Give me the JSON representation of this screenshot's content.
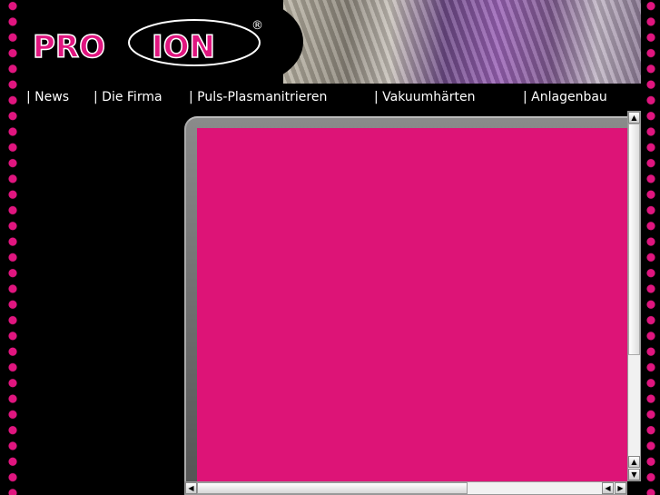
{
  "logo": {
    "text_left": "PRO",
    "text_right": "ION",
    "reg": "®"
  },
  "nav": [
    {
      "label": "| News"
    },
    {
      "label": "| Die Firma"
    },
    {
      "label": "| Puls-Plasmanitrieren"
    },
    {
      "label": "| Vakuumhärten"
    },
    {
      "label": "| Anlagenbau"
    }
  ],
  "colors": {
    "accent": "#dd1477",
    "background": "#000000"
  }
}
